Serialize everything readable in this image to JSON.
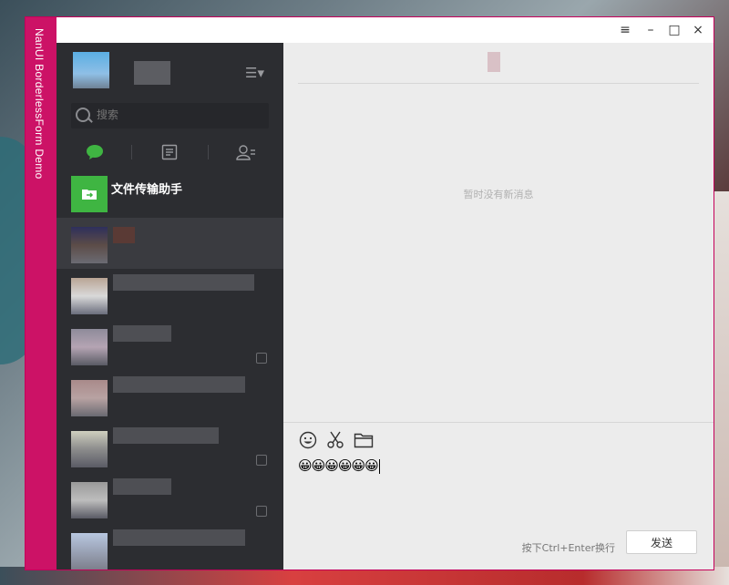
{
  "app": {
    "vertical_title": "NanUI BorderlessForm Demo"
  },
  "titlebar": {
    "menu_icon": "≡",
    "minimize_icon": "–",
    "maximize_icon": "□",
    "close_icon": "×"
  },
  "sidebar": {
    "search_placeholder": "搜索",
    "tabs": [
      "chat",
      "docs",
      "contacts"
    ],
    "chats": [
      {
        "name": "文件传输助手"
      },
      {
        "name": ""
      },
      {
        "name": ""
      },
      {
        "name": ""
      },
      {
        "name": ""
      },
      {
        "name": ""
      },
      {
        "name": ""
      },
      {
        "name": ""
      }
    ]
  },
  "chat_pane": {
    "empty_message": "暂时没有新消息",
    "composer_text": "😀😀😀😀😀😀",
    "hint": "按下Ctrl+Enter换行",
    "send_label": "发送"
  },
  "colors": {
    "brand": "#cc1266",
    "sidebar": "#2c2d31",
    "accent": "#3fb542"
  }
}
